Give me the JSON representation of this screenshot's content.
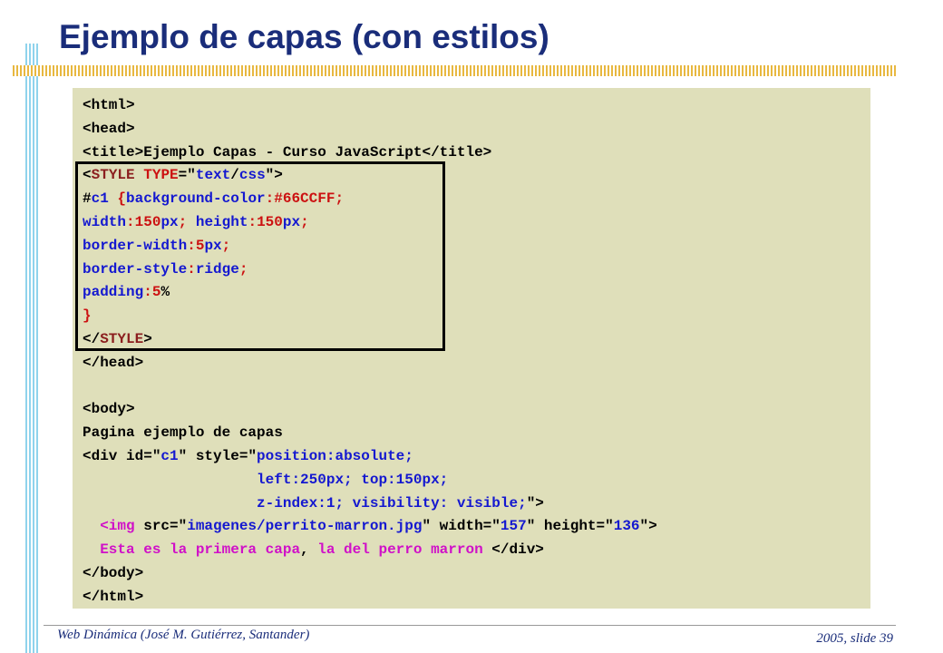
{
  "slide": {
    "title": "Ejemplo de capas (con estilos)",
    "footer_left": "Web Dinámica (José M. Gutiérrez, Santander)",
    "footer_right": "2005, slide 39"
  },
  "colors": {
    "title": "#1a2d7a",
    "panel": "#dfdfba",
    "tag": "#000000",
    "name": "#8b1e1e",
    "value": "#1418d0",
    "number": "#cc1111",
    "pink": "#d010c8",
    "accent_bar": "#8fd3ec",
    "rule_bar": "#e8b840"
  },
  "code_lines": [
    [
      {
        "t": "<html>",
        "c": "blk"
      }
    ],
    [
      {
        "t": "<head>",
        "c": "blk"
      }
    ],
    [
      {
        "t": "<title>",
        "c": "blk"
      },
      {
        "t": "Ejemplo Capas - Curso JavaScript",
        "c": "blk"
      },
      {
        "t": "</title>",
        "c": "blk"
      }
    ],
    [
      {
        "t": "<",
        "c": "blk"
      },
      {
        "t": "STYLE",
        "c": "name"
      },
      {
        "t": " ",
        "c": "blk"
      },
      {
        "t": "TYPE",
        "c": "red"
      },
      {
        "t": "=\"",
        "c": "blk"
      },
      {
        "t": "text",
        "c": "val"
      },
      {
        "t": "/",
        "c": "blk"
      },
      {
        "t": "css",
        "c": "val"
      },
      {
        "t": "\">",
        "c": "blk"
      }
    ],
    [
      {
        "t": "#",
        "c": "blk"
      },
      {
        "t": "c1",
        "c": "val"
      },
      {
        "t": " {",
        "c": "red"
      },
      {
        "t": "background-color",
        "c": "val"
      },
      {
        "t": ":",
        "c": "red"
      },
      {
        "t": "#66CCFF",
        "c": "red"
      },
      {
        "t": ";",
        "c": "red"
      }
    ],
    [
      {
        "t": "width",
        "c": "val"
      },
      {
        "t": ":",
        "c": "red"
      },
      {
        "t": "150",
        "c": "red"
      },
      {
        "t": "px",
        "c": "val"
      },
      {
        "t": "; ",
        "c": "red"
      },
      {
        "t": "height",
        "c": "val"
      },
      {
        "t": ":",
        "c": "red"
      },
      {
        "t": "150",
        "c": "red"
      },
      {
        "t": "px",
        "c": "val"
      },
      {
        "t": ";",
        "c": "red"
      }
    ],
    [
      {
        "t": "border-width",
        "c": "val"
      },
      {
        "t": ":",
        "c": "red"
      },
      {
        "t": "5",
        "c": "red"
      },
      {
        "t": "px",
        "c": "val"
      },
      {
        "t": ";",
        "c": "red"
      }
    ],
    [
      {
        "t": "border-style",
        "c": "val"
      },
      {
        "t": ":",
        "c": "red"
      },
      {
        "t": "ridge",
        "c": "val"
      },
      {
        "t": ";",
        "c": "red"
      }
    ],
    [
      {
        "t": "padding",
        "c": "val"
      },
      {
        "t": ":",
        "c": "red"
      },
      {
        "t": "5",
        "c": "red"
      },
      {
        "t": "%",
        "c": "blk"
      }
    ],
    [
      {
        "t": "}",
        "c": "red"
      }
    ],
    [
      {
        "t": "</",
        "c": "blk"
      },
      {
        "t": "STYLE",
        "c": "name"
      },
      {
        "t": ">",
        "c": "blk"
      }
    ],
    [
      {
        "t": "</head>",
        "c": "blk"
      }
    ],
    [
      {
        "t": "",
        "c": "blk"
      }
    ],
    [
      {
        "t": "<body>",
        "c": "blk"
      }
    ],
    [
      {
        "t": "Pagina ejemplo de capas",
        "c": "blk"
      }
    ],
    [
      {
        "t": "<div id=\"",
        "c": "blk"
      },
      {
        "t": "c1",
        "c": "val"
      },
      {
        "t": "\" style=\"",
        "c": "blk"
      },
      {
        "t": "position:absolute;",
        "c": "val"
      }
    ],
    [
      {
        "t": "                    ",
        "c": "blk"
      },
      {
        "t": "left:250px; top:150px;",
        "c": "val"
      }
    ],
    [
      {
        "t": "                    ",
        "c": "blk"
      },
      {
        "t": "z-index:1; visibility: visible;",
        "c": "val"
      },
      {
        "t": "\">",
        "c": "blk"
      }
    ],
    [
      {
        "t": "  ",
        "c": "blk"
      },
      {
        "t": "<img",
        "c": "pink"
      },
      {
        "t": " src=\"",
        "c": "blk"
      },
      {
        "t": "imagenes/perrito-marron.jpg",
        "c": "val"
      },
      {
        "t": "\" width=\"",
        "c": "blk"
      },
      {
        "t": "157",
        "c": "val"
      },
      {
        "t": "\" height=\"",
        "c": "blk"
      },
      {
        "t": "136",
        "c": "val"
      },
      {
        "t": "\">",
        "c": "blk"
      }
    ],
    [
      {
        "t": "  ",
        "c": "blk"
      },
      {
        "t": "Esta es la primera capa",
        "c": "pink"
      },
      {
        "t": ", ",
        "c": "blk"
      },
      {
        "t": "la del perro marron",
        "c": "pink"
      },
      {
        "t": " </div>",
        "c": "blk"
      }
    ],
    [
      {
        "t": "</body>",
        "c": "blk"
      }
    ],
    [
      {
        "t": "</html>",
        "c": "blk"
      }
    ]
  ]
}
